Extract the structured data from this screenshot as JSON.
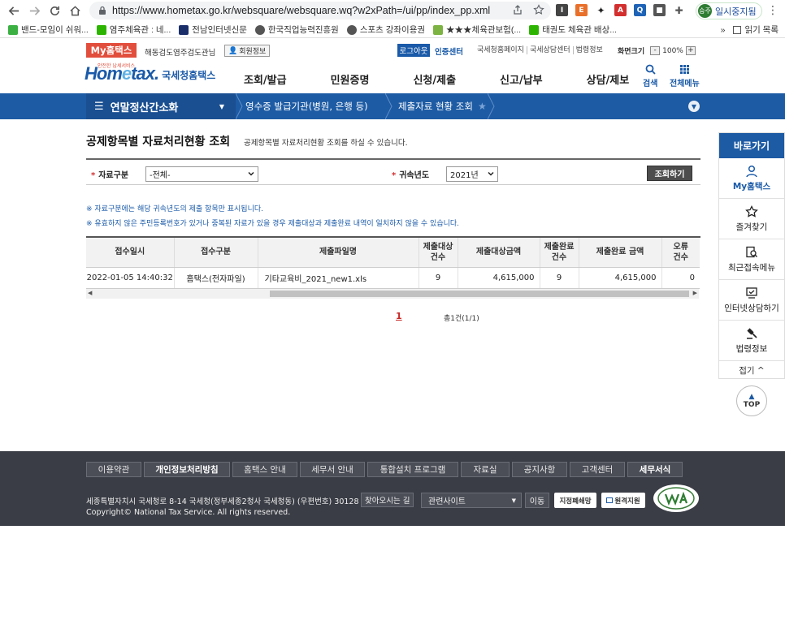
{
  "browser": {
    "url": "https://www.hometax.go.kr/websquare/websquare.wq?w2xPath=/ui/pp/index_pp.xml",
    "profile_label": "일시중지됨",
    "profile_avatar": "승주"
  },
  "bookmarks": {
    "items": [
      "밴드-모임이 쉬워...",
      "염주체육관 : 네...",
      "전남인터넷신문",
      "한국직업능력진흥원",
      "스포츠 강좌이용권",
      "★★★체육관보험(...",
      "태권도 체육관 배상..."
    ],
    "more": "»",
    "reading_list": "읽기 목록"
  },
  "util": {
    "my_hometax": "My홈택스",
    "username": "해동검도염주검도관님",
    "member_info": "회원정보",
    "logout": "로그아웃",
    "cert_center": "인증센터",
    "links": [
      "국세청홈페이지",
      "국세상담센터",
      "법령정보"
    ],
    "zoom_label": "화면크기",
    "zoom_value": "100%",
    "zoom_minus": "-",
    "zoom_plus": "+"
  },
  "header": {
    "logo_tag": "안전한 납세서비스",
    "logo_ho": "Hom",
    "logo_e": "e",
    "logo_tax": "tax.",
    "logo_kr": "국세청홈택스",
    "menu": [
      "조회/발급",
      "민원증명",
      "신청/제출",
      "신고/납부",
      "상담/제보"
    ],
    "search_label": "검색",
    "all_menu_label": "전체메뉴"
  },
  "breadcrumb": {
    "first": "연말정산간소화",
    "second": "영수증 발급기관(병원, 은행 등)",
    "third": "제출자료 현황 조회"
  },
  "page": {
    "title": "공제항목별 자료처리현황 조회",
    "desc": "공제항목별 자료처리현황 조회를 하실 수 있습니다."
  },
  "search": {
    "type_label": "자료구분",
    "type_value": "-전체-",
    "year_label": "귀속년도",
    "year_value": "2021년",
    "button": "조회하기"
  },
  "notes": [
    "※ 자료구분에는 해당 귀속년도의 제출 항목만 표시됩니다.",
    "※ 유효하지 않은 주민등록번호가 있거나 중복된 자료가 있을 경우 제출대상과 제출완료 내역이 일치하지 않을 수 있습니다."
  ],
  "table": {
    "headers": [
      "접수일시",
      "접수구분",
      "제출파일명",
      "제출대상\n건수",
      "제출대상금액",
      "제출완료\n건수",
      "제출완료 금액",
      "오류\n건수"
    ],
    "rows": [
      [
        "2022-01-05 14:40:32",
        "홈택스(전자파일)",
        "기타교육비_2021_new1.xls",
        "9",
        "4,615,000",
        "9",
        "4,615,000",
        "0"
      ]
    ]
  },
  "pager": {
    "current": "1",
    "total": "총1건(1/1)"
  },
  "quick": {
    "title": "바로가기",
    "items": [
      "My홈택스",
      "즐겨찾기",
      "최근접속메뉴",
      "인터넷상담하기",
      "법령정보"
    ],
    "collapse": "접기 ^",
    "top": "TOP"
  },
  "footer": {
    "links": [
      "이용약관",
      "개인정보처리방침",
      "홈택스 안내",
      "세무서 안내",
      "통합설치 프로그램",
      "자료실",
      "공지사항",
      "고객센터",
      "세무서식"
    ],
    "address": "세종특별자치시 국세청로 8-14 국세청(정부세종2청사 국세청동) (우편번호) 30128",
    "directions": "찾아오시는 길",
    "copyright": "Copyright© National Tax Service. All rights reserved.",
    "related_sites": "관련사이트",
    "go": "이동",
    "badge1": "지정폐쇄망",
    "badge2": "원격지원"
  },
  "colors": {
    "brand_blue": "#1d5ba4",
    "my_hometax_red": "#e24e3c",
    "footer_bg": "#3a3d45"
  }
}
